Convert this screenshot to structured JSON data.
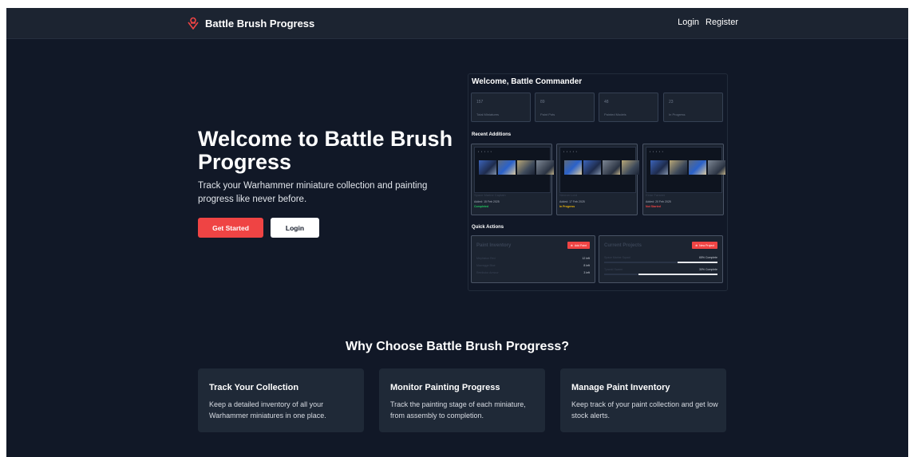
{
  "nav": {
    "brand": "Battle Brush Progress",
    "login": "Login",
    "register": "Register"
  },
  "hero": {
    "title": "Welcome to Battle Brush Progress",
    "subtitle": "Track your Warhammer miniature collection and painting progress like never before.",
    "cta_primary": "Get Started",
    "cta_secondary": "Login"
  },
  "dashboard": {
    "title": "Welcome, Battle Commander",
    "stats": [
      {
        "value": "157",
        "label": "Total Miniatures"
      },
      {
        "value": "89",
        "label": "Paint Pots"
      },
      {
        "value": "48",
        "label": "Painted Models"
      },
      {
        "value": "23",
        "label": "In Progress"
      }
    ],
    "recent_label": "Recent Additions",
    "recent": [
      {
        "name": "Space Marine Captain",
        "date": "Added: 15 Feb 2025",
        "status": "Completed",
        "status_color": "#22c55e"
      },
      {
        "name": "Necron Lord",
        "date": "Added: 17 Feb 2025",
        "status": "In Progress",
        "status_color": "#eab308"
      },
      {
        "name": "Eldar Farseer",
        "date": "Added: 20 Feb 2025",
        "status": "Not Started",
        "status_color": "#ef4444"
      }
    ],
    "quick_label": "Quick Actions",
    "paint_inventory": {
      "title": "Paint Inventory",
      "button": "Add Paint",
      "rows": [
        {
          "name": "Mephiston Red",
          "value": "12 left"
        },
        {
          "name": "Macragge Blue",
          "value": "8 left"
        },
        {
          "name": "Retributor Armour",
          "value": "3 left"
        }
      ]
    },
    "current_projects": {
      "title": "Current Projects",
      "button": "New Project",
      "rows": [
        {
          "name": "Space Marine Squad",
          "value": "65% Complete",
          "progress": 0.35
        },
        {
          "name": "Tyranid Swarm",
          "value": "30% Complete",
          "progress": 0.7
        }
      ]
    }
  },
  "why": {
    "title": "Why Choose Battle Brush Progress?",
    "features": [
      {
        "title": "Track Your Collection",
        "desc": "Keep a detailed inventory of all your Warhammer miniatures in one place."
      },
      {
        "title": "Monitor Painting Progress",
        "desc": "Track the painting stage of each miniature, from assembly to completion."
      },
      {
        "title": "Manage Paint Inventory",
        "desc": "Keep track of your paint collection and get low stock alerts."
      }
    ]
  },
  "colors": {
    "background": "#111827",
    "nav": "#1c2431",
    "card": "#1f2937",
    "accent": "#ef4444"
  }
}
